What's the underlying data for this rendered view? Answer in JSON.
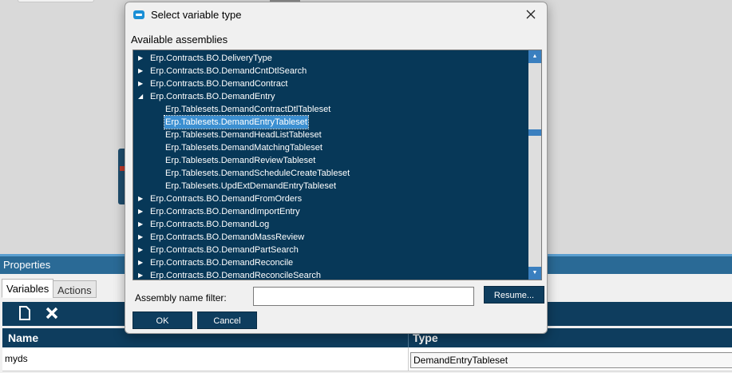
{
  "properties": {
    "title": "Properties",
    "tabs": [
      "Variables",
      "Actions"
    ],
    "toolbar": {
      "new_icon": "new-document-icon",
      "delete_icon": "delete-x-icon"
    },
    "grid": {
      "columns": [
        "Name",
        "Type"
      ],
      "rows": [
        {
          "name": "myds",
          "type": "DemandEntryTableset"
        }
      ]
    }
  },
  "dialog": {
    "title": "Select variable type",
    "assemblies_label": "Available assemblies",
    "tree": [
      {
        "label": "Erp.Contracts.BO.DeliveryType",
        "expanded": false
      },
      {
        "label": "Erp.Contracts.BO.DemandCntDtlSearch",
        "expanded": false
      },
      {
        "label": "Erp.Contracts.BO.DemandContract",
        "expanded": false
      },
      {
        "label": "Erp.Contracts.BO.DemandEntry",
        "expanded": true
      },
      {
        "label": "Erp.Tablesets.DemandContractDtlTableset",
        "child": true
      },
      {
        "label": "Erp.Tablesets.DemandEntryTableset",
        "child": true,
        "selected": true
      },
      {
        "label": "Erp.Tablesets.DemandHeadListTableset",
        "child": true
      },
      {
        "label": "Erp.Tablesets.DemandMatchingTableset",
        "child": true
      },
      {
        "label": "Erp.Tablesets.DemandReviewTableset",
        "child": true
      },
      {
        "label": "Erp.Tablesets.DemandScheduleCreateTableset",
        "child": true
      },
      {
        "label": "Erp.Tablesets.UpdExtDemandEntryTableset",
        "child": true
      },
      {
        "label": "Erp.Contracts.BO.DemandFromOrders",
        "expanded": false
      },
      {
        "label": "Erp.Contracts.BO.DemandImportEntry",
        "expanded": false
      },
      {
        "label": "Erp.Contracts.BO.DemandLog",
        "expanded": false
      },
      {
        "label": "Erp.Contracts.BO.DemandMassReview",
        "expanded": false
      },
      {
        "label": "Erp.Contracts.BO.DemandPartSearch",
        "expanded": false
      },
      {
        "label": "Erp.Contracts.BO.DemandReconcile",
        "expanded": false
      },
      {
        "label": "Erp.Contracts.BO.DemandReconcileSearch",
        "expanded": false
      }
    ],
    "filter_label": "Assembly name filter:",
    "filter_value": "",
    "resume_label": "Resume...",
    "ok_label": "OK",
    "cancel_label": "Cancel",
    "colors": {
      "tree_bg": "#073858",
      "selection": "#3b8fd1",
      "button": "#0e3d5e",
      "scrollbar": "#3a7fbf"
    }
  }
}
